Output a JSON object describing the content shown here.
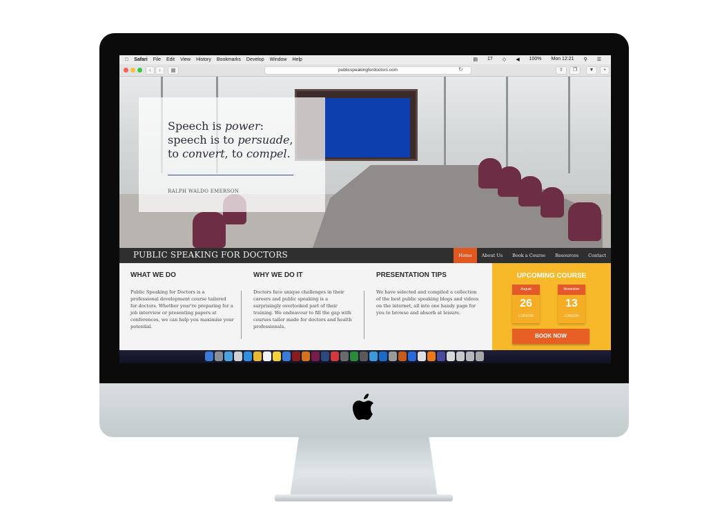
{
  "menubar": {
    "apple": "",
    "items": [
      "Safari",
      "File",
      "Edit",
      "View",
      "History",
      "Bookmarks",
      "Develop",
      "Window",
      "Help"
    ],
    "status": [
      "17",
      "100%",
      "Mon 12:21"
    ]
  },
  "browser": {
    "url": "publicspeakingfordoctors.com"
  },
  "hero": {
    "quote_1a": "Speech is ",
    "quote_1b": "power",
    "quote_1c": ":",
    "quote_2a": "speech is to ",
    "quote_2b": "persuade",
    "quote_2c": ",",
    "quote_3a": "to ",
    "quote_3b": "convert",
    "quote_3c": ", to ",
    "quote_3d": "compel.",
    "author": "RALPH WALDO EMERSON"
  },
  "nav": {
    "brand": "PUBLIC SPEAKING FOR DOCTORS",
    "links": [
      "Home",
      "About Us",
      "Book a Course",
      "Resources",
      "Contact"
    ]
  },
  "sections": [
    {
      "title": "WHAT WE DO",
      "body": "Public Speaking for Doctors is a professional development course tailored for doctors. Whether your're preparing for a job interview or presenting papers at conferences, we can help you maximise your potential."
    },
    {
      "title": "WHY WE DO IT",
      "body": "Doctors face unique challenges in their careers and public speaking is a surprisingly overlooked part of their training. We endeavour to fill the gap with courses tailor made for doctors and health professionals."
    },
    {
      "title": "PRESENTATION TIPS",
      "body": "We have selected and compiled a collection of the best public speaking blogs and videos on the internet, all into one handy page for you to browse and absorb at leisure."
    }
  ],
  "course": {
    "title": "UPCOMING COURSE",
    "dates": [
      {
        "month": "August",
        "day": "26",
        "city": "LONDON"
      },
      {
        "month": "November",
        "day": "13",
        "city": "LONDON"
      }
    ],
    "button": "BOOK NOW"
  },
  "colors": {
    "accent": "#e2571d",
    "course_bg": "#f7b92a",
    "nav_bg": "#2f2f2f"
  }
}
